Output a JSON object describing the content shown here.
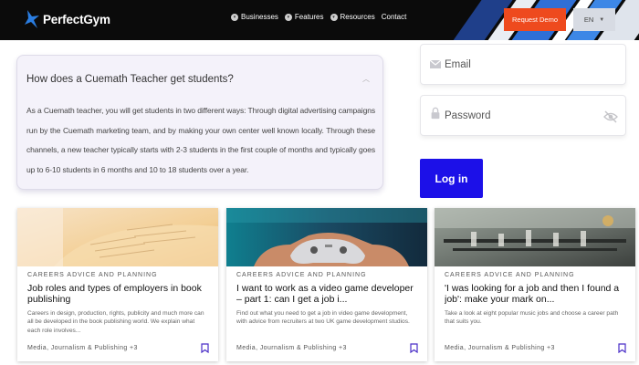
{
  "header": {
    "brand": "PerfectGym",
    "nav": [
      {
        "label": "Businesses",
        "icon": "chevron-icon"
      },
      {
        "label": "Features",
        "icon": "chevron-icon"
      },
      {
        "label": "Resources",
        "icon": "chevron-icon"
      },
      {
        "label": "Contact"
      }
    ],
    "demo_button": "Request Demo",
    "language": "EN",
    "accent": "#ee4a1e"
  },
  "faq": {
    "question": "How does a Cuemath Teacher get students?",
    "answer": "As a Cuemath teacher, you will get students in two different ways: Through digital advertising campaigns run by the Cuemath marketing team, and by making your own center well known locally. Through these channels, a new teacher typically starts with 2-3 students in the first couple of months and typically goes up to 6-10 students in 6 months and 10 to 18 students over a year."
  },
  "login": {
    "email_placeholder": "Email",
    "password_placeholder": "Password",
    "button": "Log in",
    "button_color": "#1c10e8"
  },
  "cards": [
    {
      "category": "CAREERS ADVICE AND PLANNING",
      "title": "Job roles and types of employers in book publishing",
      "description": "Careers in design, production, rights, publicity and much more can all be developed in the book publishing world. We explain what each role involves...",
      "tags": "Media, Journalism & Publishing +3"
    },
    {
      "category": "CAREERS ADVICE AND PLANNING",
      "title": "I want to work as a video game developer – part 1: can I get a job i...",
      "description": "Find out what you need to get a job in video game development, with advice from recruiters at two UK game development studios.",
      "tags": "Media, Journalism & Publishing +3"
    },
    {
      "category": "CAREERS ADVICE AND PLANNING",
      "title": "'I was looking for a job and then I found a job': make your mark on...",
      "description": "Take a look at eight popular music jobs and choose a career path that suits you.",
      "tags": "Media, Journalism & Publishing +3"
    }
  ]
}
